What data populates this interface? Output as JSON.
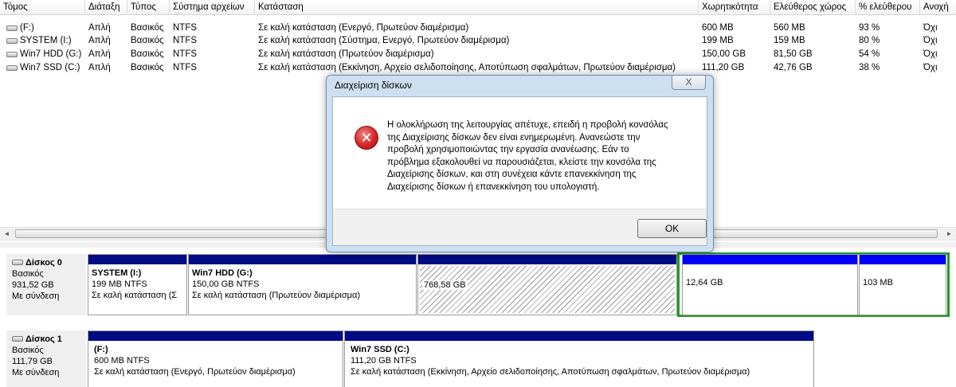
{
  "columns": [
    "Τόμος",
    "Διάταξη",
    "Τύπος",
    "Σύστημα αρχείων",
    "Κατάσταση",
    "Χωρητικότητα",
    "Ελεύθερος χώρος",
    "% ελεύθερου",
    "Ανοχή"
  ],
  "volumes": [
    {
      "name": "(F:)",
      "layout": "Απλή",
      "type": "Βασικός",
      "fs": "NTFS",
      "status": "Σε καλή κατάσταση (Ενεργό, Πρωτεύον διαμέρισμα)",
      "capacity": "600 MB",
      "free": "560 MB",
      "pct": "93 %",
      "fault": "Όχι"
    },
    {
      "name": "SYSTEM (I:)",
      "layout": "Απλή",
      "type": "Βασικός",
      "fs": "NTFS",
      "status": "Σε καλή κατάσταση (Σύστημα, Ενεργό, Πρωτεύον διαμέρισμα)",
      "capacity": "199 MB",
      "free": "159 MB",
      "pct": "80 %",
      "fault": "Όχι"
    },
    {
      "name": "Win7 HDD (G:)",
      "layout": "Απλή",
      "type": "Βασικός",
      "fs": "NTFS",
      "status": "Σε καλή κατάσταση (Πρωτεύον διαμέρισμα)",
      "capacity": "150,00 GB",
      "free": "81,50 GB",
      "pct": "54 %",
      "fault": "Όχι"
    },
    {
      "name": "Win7 SSD (C:)",
      "layout": "Απλή",
      "type": "Βασικός",
      "fs": "NTFS",
      "status": "Σε καλή κατάσταση (Εκκίνηση, Αρχείο σελιδοποίησης, Αποτύπωση σφαλμάτων, Πρωτεύον διαμέρισμα)",
      "capacity": "111,20 GB",
      "free": "42,76 GB",
      "pct": "38 %",
      "fault": "Όχι"
    }
  ],
  "disks": [
    {
      "name": "Δίσκος 0",
      "type": "Βασικός",
      "size": "931,52 GB",
      "status": "Με σύνδεση",
      "partitions": [
        {
          "name": "SYSTEM  (I:)",
          "size": "199 MB NTFS",
          "status": "Σε καλή κατάσταση (Σ"
        },
        {
          "name": "Win7 HDD  (G:)",
          "size": "150,00 GB NTFS",
          "status": "Σε καλή κατάσταση (Πρωτεύον διαμέρισμα)"
        },
        {
          "label": "768,58 GB"
        },
        {
          "label": "12,64 GB"
        },
        {
          "label": "103 MB"
        }
      ]
    },
    {
      "name": "Δίσκος 1",
      "type": "Βασικός",
      "size": "111,79 GB",
      "status": "Με σύνδεση",
      "partitions": [
        {
          "name": "(F:)",
          "size": "600 MB NTFS",
          "status": "Σε καλή κατάσταση (Ενεργό, Πρωτεύον διαμέρισμα)"
        },
        {
          "name": "Win7 SSD  (C:)",
          "size": "111,20 GB NTFS",
          "status": "Σε καλή κατάσταση (Εκκίνηση, Αρχείο σελιδοποίησης, Αποτύπωση σφαλμάτων, Πρωτεύον διαμέρισμα)"
        }
      ]
    }
  ],
  "dialog": {
    "title": "Διαχείριση δίσκων",
    "close": "X",
    "icon": "error-icon",
    "icon_glyph": "✕",
    "message_lines": [
      "Η ολοκλήρωση της λειτουργίας απέτυχε, επειδή η προβολή κονσόλας",
      "της Διαχείρισης δίσκων δεν είναι ενημερωμένη. Ανανεώστε την",
      "προβολή χρησιμοποιώντας την εργασία ανανέωσης. Εάν το",
      "πρόβλημα εξακολουθεί να παρουσιάζεται, κλείστε την κονσόλα της",
      "Διαχείρισης δίσκων, και στη συνέχεια κάντε επανεκκίνηση της",
      "Διαχείρισης δίσκων ή επανεκκίνηση του υπολογιστή."
    ],
    "ok_label": "OK"
  },
  "scrollbar": {
    "left_arrow": "◄",
    "right_arrow": "►"
  },
  "colors": {
    "primary_bar": "#000b84",
    "logical_bar": "#0000ff",
    "extended_border": "#1e9c1e",
    "error_red": "#d52525"
  }
}
